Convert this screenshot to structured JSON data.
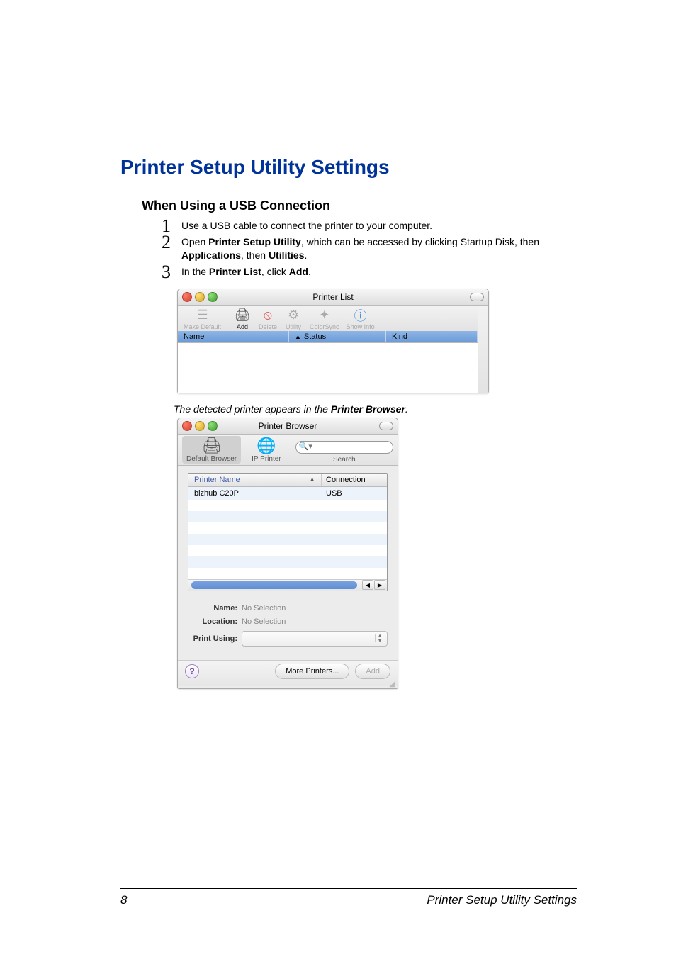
{
  "heading": "Printer Setup Utility Settings",
  "subheading": "When Using a USB Connection",
  "steps": {
    "one": {
      "num": "1",
      "text": "Use a USB cable to connect the printer to your computer."
    },
    "two": {
      "num": "2",
      "pre": "Open ",
      "b1": "Printer Setup Utility",
      "mid1": ", which can be accessed by clicking Startup Disk, then ",
      "b2": "Applications",
      "mid2": ", then ",
      "b3": "Utilities",
      "post": "."
    },
    "three": {
      "num": "3",
      "pre": "In the ",
      "b1": "Printer List",
      "mid": ", click ",
      "b2": "Add",
      "post": "."
    }
  },
  "win1": {
    "title": "Printer List",
    "toolbar": {
      "make_default": "Make Default",
      "add": "Add",
      "delete": "Delete",
      "utility": "Utility",
      "colorsync": "ColorSync",
      "show_info": "Show Info"
    },
    "columns": {
      "name": "Name",
      "status": "Status",
      "kind": "Kind"
    }
  },
  "caption": {
    "pre": "The detected printer appears in the ",
    "b": "Printer Browser",
    "post": "."
  },
  "win2": {
    "title": "Printer Browser",
    "tabs": {
      "default": "Default Browser",
      "ip": "IP Printer",
      "search": "Search"
    },
    "search_placeholder": "",
    "columns": {
      "printer_name": "Printer Name",
      "connection": "Connection"
    },
    "row": {
      "name": "bizhub C20P",
      "conn": "USB"
    },
    "form": {
      "name_label": "Name:",
      "name_value": "No Selection",
      "location_label": "Location:",
      "location_value": "No Selection",
      "print_using_label": "Print Using:"
    },
    "buttons": {
      "help": "?",
      "more": "More Printers...",
      "add": "Add"
    }
  },
  "footer": {
    "page": "8",
    "text": "Printer Setup Utility Settings"
  }
}
